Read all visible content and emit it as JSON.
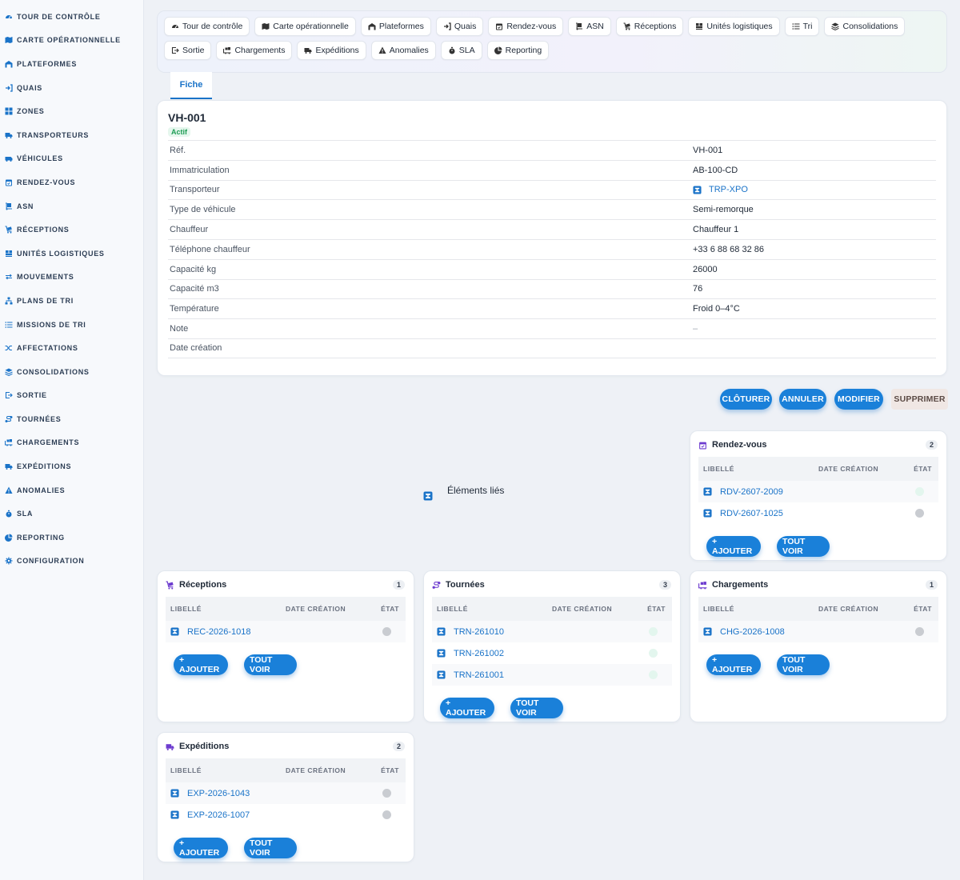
{
  "sidebar": {
    "items": [
      {
        "label": "Tour de contrôle",
        "icon": "gauge-icon"
      },
      {
        "label": "Carte opérationnelle",
        "icon": "map-icon"
      },
      {
        "label": "Plateformes",
        "icon": "warehouse-icon"
      },
      {
        "label": "Quais",
        "icon": "dock-icon"
      },
      {
        "label": "Zones",
        "icon": "grid-icon"
      },
      {
        "label": "Transporteurs",
        "icon": "truck-icon"
      },
      {
        "label": "Véhicules",
        "icon": "van-icon"
      },
      {
        "label": "Rendez-vous",
        "icon": "calendar-icon"
      },
      {
        "label": "ASN",
        "icon": "dolly-icon"
      },
      {
        "label": "Réceptions",
        "icon": "cart-icon"
      },
      {
        "label": "Unités logistiques",
        "icon": "pallet-icon"
      },
      {
        "label": "Mouvements",
        "icon": "arrows-icon"
      },
      {
        "label": "Plans de tri",
        "icon": "sitemap-icon"
      },
      {
        "label": "Missions de tri",
        "icon": "list-icon"
      },
      {
        "label": "Affectations",
        "icon": "shuffle-icon"
      },
      {
        "label": "Consolidations",
        "icon": "layers-icon"
      },
      {
        "label": "Sortie",
        "icon": "exit-icon"
      },
      {
        "label": "Tournées",
        "icon": "route-icon"
      },
      {
        "label": "Chargements",
        "icon": "loading-icon"
      },
      {
        "label": "Expéditions",
        "icon": "shipping-icon"
      },
      {
        "label": "Anomalies",
        "icon": "warning-icon"
      },
      {
        "label": "SLA",
        "icon": "stopwatch-icon"
      },
      {
        "label": "Reporting",
        "icon": "pie-chart-icon"
      },
      {
        "label": "Configuration",
        "icon": "gear-icon"
      }
    ]
  },
  "tabs": [
    {
      "label": "Tour de contrôle",
      "icon": "gauge-icon"
    },
    {
      "label": "Carte opérationnelle",
      "icon": "map-icon"
    },
    {
      "label": "Plateformes",
      "icon": "warehouse-icon"
    },
    {
      "label": "Quais",
      "icon": "dock-icon"
    },
    {
      "label": "Rendez-vous",
      "icon": "calendar-icon"
    },
    {
      "label": "ASN",
      "icon": "dolly-icon"
    },
    {
      "label": "Réceptions",
      "icon": "cart-icon"
    },
    {
      "label": "Unités logistiques",
      "icon": "pallet-icon"
    },
    {
      "label": "Tri",
      "icon": "list-icon"
    },
    {
      "label": "Consolidations",
      "icon": "layers-icon"
    },
    {
      "label": "Sortie",
      "icon": "exit-icon"
    },
    {
      "label": "Chargements",
      "icon": "loading-icon"
    },
    {
      "label": "Expéditions",
      "icon": "shipping-icon"
    },
    {
      "label": "Anomalies",
      "icon": "warning-icon"
    },
    {
      "label": "SLA",
      "icon": "stopwatch-icon"
    },
    {
      "label": "Reporting",
      "icon": "pie-chart-icon"
    }
  ],
  "fiche_tab": "Fiche",
  "record": {
    "title": "VH-001",
    "status": "Actif",
    "fields": [
      {
        "key": "Réf.",
        "value": "VH-001"
      },
      {
        "key": "Immatriculation",
        "value": "AB-100-CD"
      },
      {
        "key": "Transporteur",
        "value": "TRP-XPO",
        "link": true
      },
      {
        "key": "Type de véhicule",
        "value": "Semi-remorque"
      },
      {
        "key": "Chauffeur",
        "value": "Chauffeur 1"
      },
      {
        "key": "Téléphone chauffeur",
        "value": "+33 6 88 68 32 86"
      },
      {
        "key": "Capacité kg",
        "value": "26000"
      },
      {
        "key": "Capacité m3",
        "value": "76"
      },
      {
        "key": "Température",
        "value": "Froid 0–4°C"
      },
      {
        "key": "Note",
        "value": "–",
        "muted": true
      },
      {
        "key": "Date création",
        "value": ""
      }
    ]
  },
  "actions": {
    "close": "Clôturer",
    "cancel": "Annuler",
    "edit": "Modifier",
    "delete": "Supprimer"
  },
  "linked": {
    "title": "Éléments liés",
    "columns": {
      "label": "Libellé",
      "date": "Date création",
      "state": "État"
    },
    "add_label": "+ Ajouter",
    "all_label": "Tout voir",
    "colors": {
      "accent": "#1a80d9",
      "state_grey": "#c9ccd1",
      "state_mint": "#e3f6ee",
      "section_icon": "#6d3ccf"
    },
    "sections": [
      {
        "key": "rdv",
        "title": "Rendez-vous",
        "count": "2",
        "icon": "calendar-icon",
        "rows": [
          {
            "label": "RDV-2607-2009",
            "date": "",
            "state": "mint"
          },
          {
            "label": "RDV-2607-1025",
            "date": "",
            "state": "grey"
          }
        ]
      },
      {
        "key": "receptions",
        "title": "Réceptions",
        "count": "1",
        "icon": "cart-icon",
        "rows": [
          {
            "label": "REC-2026-1018",
            "date": "",
            "state": "grey"
          }
        ]
      },
      {
        "key": "tournees",
        "title": "Tournées",
        "count": "3",
        "icon": "route-icon",
        "rows": [
          {
            "label": "TRN-261010",
            "date": "",
            "state": "mint"
          },
          {
            "label": "TRN-261002",
            "date": "",
            "state": "mint"
          },
          {
            "label": "TRN-261001",
            "date": "",
            "state": "mint"
          }
        ]
      },
      {
        "key": "chargements",
        "title": "Chargements",
        "count": "1",
        "icon": "loading-icon",
        "rows": [
          {
            "label": "CHG-2026-1008",
            "date": "",
            "state": "grey"
          }
        ]
      },
      {
        "key": "expeditions",
        "title": "Expéditions",
        "count": "2",
        "icon": "shipping-icon",
        "rows": [
          {
            "label": "EXP-2026-1043",
            "date": "",
            "state": "grey"
          },
          {
            "label": "EXP-2026-1007",
            "date": "",
            "state": "grey"
          }
        ]
      }
    ]
  }
}
